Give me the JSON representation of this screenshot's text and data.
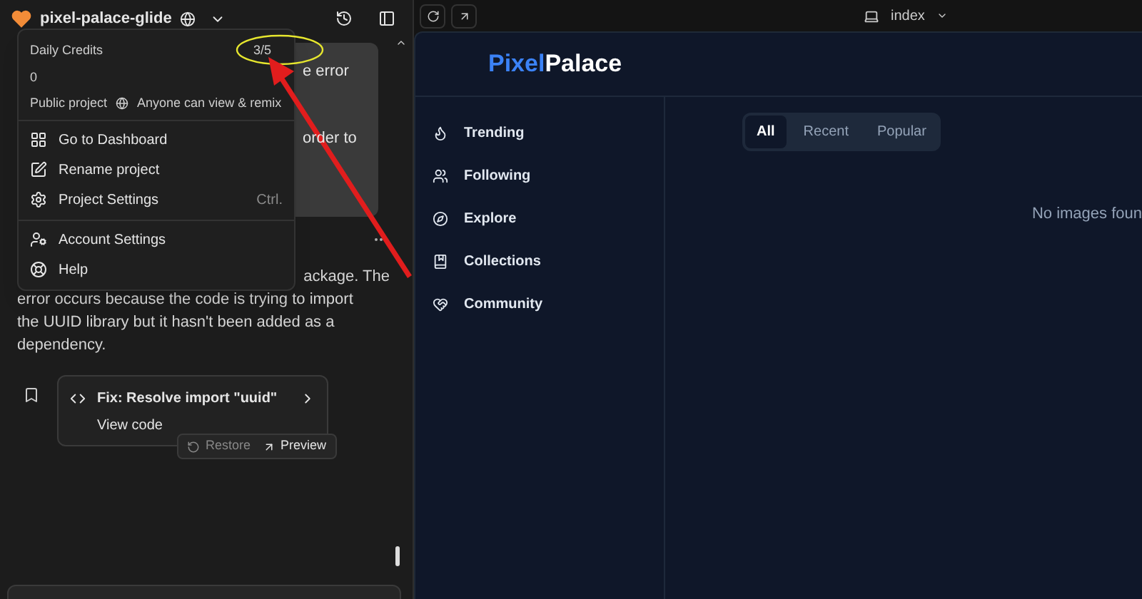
{
  "project": {
    "name": "pixel-palace-glide"
  },
  "menu": {
    "credits_label": "Daily Credits",
    "credits_value": "3/5",
    "credits_extra": "0",
    "visibility_label": "Public project",
    "visibility_note": "Anyone can view & remix",
    "items": [
      {
        "label": "Go to Dashboard"
      },
      {
        "label": "Rename project"
      },
      {
        "label": "Project Settings",
        "shortcut": "Ctrl."
      },
      {
        "label": "Account Settings"
      },
      {
        "label": "Help"
      }
    ]
  },
  "chat": {
    "bubble_lines": [
      "e error",
      "order to"
    ],
    "partial_line": "ackage. The",
    "paragraph": "error occurs because the code is trying to import the UUID library but it hasn't been added as a dependency.",
    "fix_title": "Fix: Resolve import \"uuid\"",
    "fix_link": "View code",
    "restore": "Restore",
    "preview": "Preview"
  },
  "preview": {
    "page": "index",
    "brand_first": "Pixel",
    "brand_second": "Palace",
    "nav": [
      {
        "label": "Trending"
      },
      {
        "label": "Following"
      },
      {
        "label": "Explore"
      },
      {
        "label": "Collections"
      },
      {
        "label": "Community"
      }
    ],
    "tabs": [
      {
        "label": "All",
        "selected": true
      },
      {
        "label": "Recent",
        "selected": false
      },
      {
        "label": "Popular",
        "selected": false
      }
    ],
    "empty": "No images foun"
  }
}
